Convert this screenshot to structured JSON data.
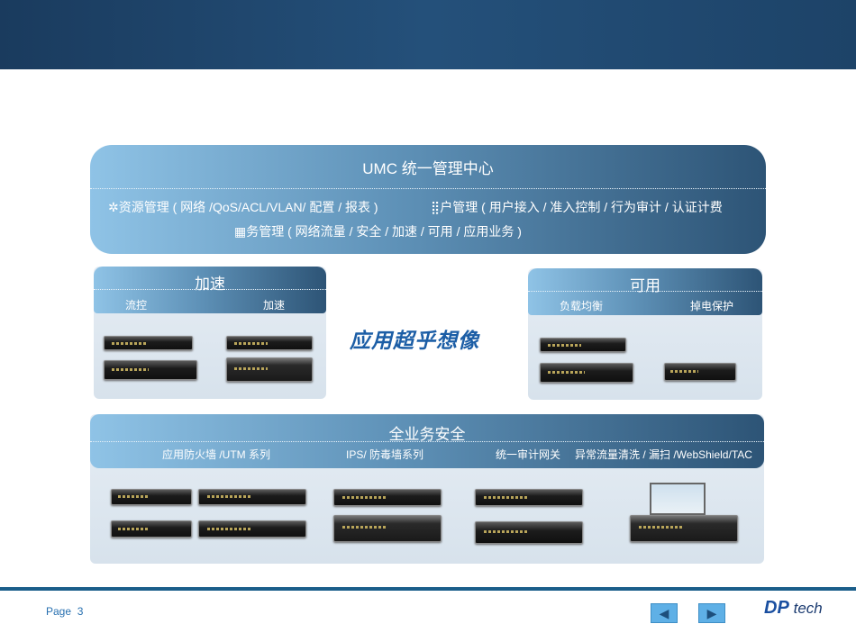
{
  "umc": {
    "title": "UMC 统一管理中心",
    "line1_a": "资源管理 ( 网络 /QoS/ACL/VLAN/ 配置 / 报表 )",
    "line1_b": "户管理 ( 用户接入 / 准入控制 / 行为审计 / 认证计费",
    "line2": "务管理 ( 网络流量 / 安全 / 加速 / 可用 / 应用业务 )"
  },
  "accel": {
    "title": "加速",
    "subs": [
      "流控",
      "加速"
    ]
  },
  "avail": {
    "title": "可用",
    "subs": [
      "负载均衡",
      "掉电保护"
    ]
  },
  "slogan": "应用超乎想像",
  "security": {
    "title": "全业务安全",
    "subs": [
      "应用防火墙 /UTM 系列",
      "IPS/ 防毒墙系列",
      "统一审计网关",
      "异常流量清洗 / 漏扫 /WebShield/TAC"
    ]
  },
  "footer": {
    "page_label": "Page",
    "page_number": "3",
    "prev": "◀",
    "next": "▶",
    "logo": "DP",
    "logo_suffix": "tech"
  }
}
